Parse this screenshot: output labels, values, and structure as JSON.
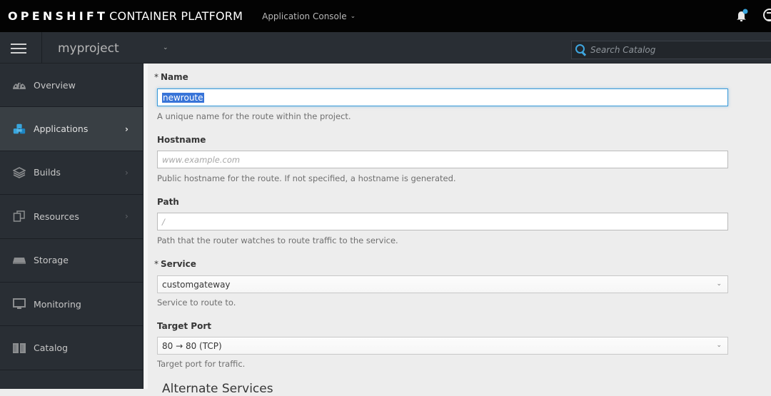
{
  "header": {
    "brand_bold": "OPENSHIFT",
    "brand_light": "CONTAINER PLATFORM",
    "console_switcher": "Application Console",
    "notification_badge_color": "#39a5dc"
  },
  "project_bar": {
    "project_name": "myproject",
    "search_placeholder": "Search Catalog"
  },
  "sidebar": {
    "items": [
      {
        "label": "Overview",
        "icon": "dashboard-icon",
        "active": false,
        "has_arrow": false
      },
      {
        "label": "Applications",
        "icon": "cubes-icon",
        "active": true,
        "has_arrow": true
      },
      {
        "label": "Builds",
        "icon": "layers-icon",
        "active": false,
        "has_arrow": true
      },
      {
        "label": "Resources",
        "icon": "files-icon",
        "active": false,
        "has_arrow": true
      },
      {
        "label": "Storage",
        "icon": "storage-icon",
        "active": false,
        "has_arrow": false
      },
      {
        "label": "Monitoring",
        "icon": "monitor-icon",
        "active": false,
        "has_arrow": false
      },
      {
        "label": "Catalog",
        "icon": "book-icon",
        "active": false,
        "has_arrow": false
      }
    ],
    "arrow_glyph": "›"
  },
  "form": {
    "required_marker": "*",
    "name": {
      "label": "Name",
      "value": "newroute",
      "help": "A unique name for the route within the project."
    },
    "hostname": {
      "label": "Hostname",
      "placeholder": "www.example.com",
      "help": "Public hostname for the route. If not specified, a hostname is generated."
    },
    "path": {
      "label": "Path",
      "placeholder": "/",
      "help": "Path that the router watches to route traffic to the service."
    },
    "service": {
      "label": "Service",
      "value": "customgateway",
      "help": "Service to route to."
    },
    "target_port": {
      "label": "Target Port",
      "value": "80 → 80 (TCP)",
      "help": "Target port for traffic."
    },
    "alternate_services_title": "Alternate Services"
  },
  "colors": {
    "accent": "#39a5dc",
    "focus_border": "#3a9ad9",
    "selection": "#3874d8"
  }
}
